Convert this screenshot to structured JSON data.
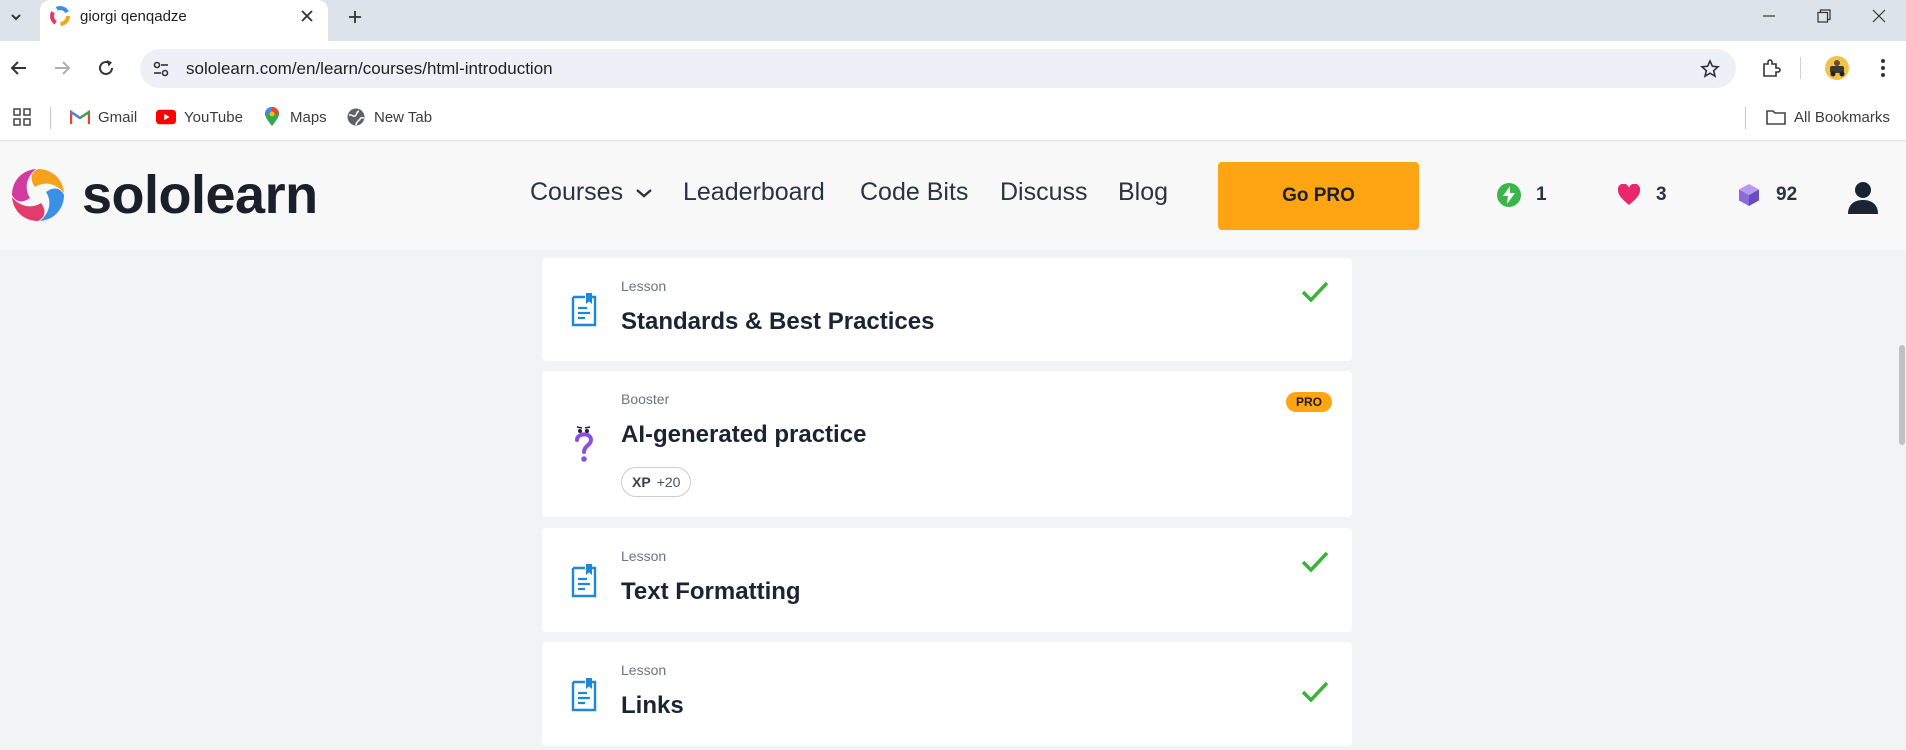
{
  "browser": {
    "tab": {
      "title": "giorgi qenqadze"
    },
    "url": "sololearn.com/en/learn/courses/html-introduction",
    "bookmarks": [
      {
        "label": "Gmail",
        "icon": "gmail-icon"
      },
      {
        "label": "YouTube",
        "icon": "youtube-icon"
      },
      {
        "label": "Maps",
        "icon": "maps-icon"
      },
      {
        "label": "New Tab",
        "icon": "globe-icon"
      }
    ],
    "all_bookmarks_label": "All Bookmarks"
  },
  "site": {
    "logo_text": "sololearn",
    "nav": {
      "courses": "Courses",
      "leaderboard": "Leaderboard",
      "code_bits": "Code Bits",
      "discuss": "Discuss",
      "blog": "Blog"
    },
    "go_pro_label": "Go PRO",
    "stats": {
      "streak": "1",
      "hearts": "3",
      "bits": "92"
    }
  },
  "lessons": [
    {
      "type": "Lesson",
      "title": "Standards & Best Practices",
      "completed": true
    },
    {
      "type": "Booster",
      "title": "AI-generated practice",
      "badge": "PRO",
      "xp_label": "XP",
      "xp_value": "+20"
    },
    {
      "type": "Lesson",
      "title": "Text Formatting",
      "completed": true
    },
    {
      "type": "Lesson",
      "title": "Links",
      "completed": true
    }
  ],
  "colors": {
    "brand_orange": "#ffa412",
    "check_green": "#3bb33b",
    "lesson_icon_blue": "#1e88d6",
    "booster_purple": "#8a4fe0",
    "heart_pink": "#e8286b",
    "streak_green": "#3bb54a",
    "bits_purple": "#8b6bd8"
  }
}
